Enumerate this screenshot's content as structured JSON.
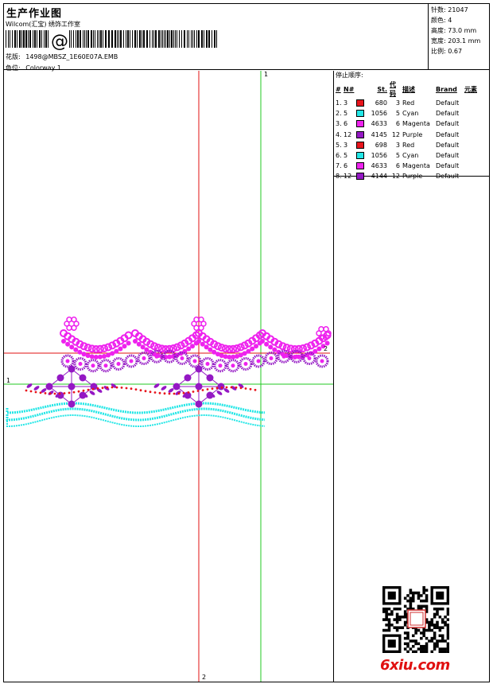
{
  "header": {
    "title": "生产作业图",
    "company": "Wilcom(汇宝) 绣饰工作室",
    "design_label": "花版:",
    "design_value": "1498@MBSZ_1E60E07A.EMB",
    "colorway_label": "色位:",
    "colorway_value": "Colorway 1"
  },
  "stats": {
    "stitches": "针数: 21047",
    "colors": "颜色: 4",
    "height": "高度: 73.0 mm",
    "width": "宽度: 203.1 mm",
    "scale": "比例: 0.67"
  },
  "stop_sequence": {
    "title": "停止顺序:",
    "columns": [
      "#",
      "N#",
      "St.",
      "代码",
      "描述",
      "Brand",
      "元素"
    ],
    "rows": [
      {
        "num": "1.",
        "n": "3",
        "color": "#e8141c",
        "st": "680",
        "code": "3",
        "desc": "Red",
        "brand": "Default"
      },
      {
        "num": "2.",
        "n": "5",
        "color": "#22e6e6",
        "st": "1056",
        "code": "5",
        "desc": "Cyan",
        "brand": "Default"
      },
      {
        "num": "3.",
        "n": "6",
        "color": "#ee22ee",
        "st": "4633",
        "code": "6",
        "desc": "Magenta",
        "brand": "Default"
      },
      {
        "num": "4.",
        "n": "12",
        "color": "#9418c4",
        "st": "4145",
        "code": "12",
        "desc": "Purple",
        "brand": "Default"
      },
      {
        "num": "5.",
        "n": "3",
        "color": "#e8141c",
        "st": "698",
        "code": "3",
        "desc": "Red",
        "brand": "Default"
      },
      {
        "num": "6.",
        "n": "5",
        "color": "#22e6e6",
        "st": "1056",
        "code": "5",
        "desc": "Cyan",
        "brand": "Default"
      },
      {
        "num": "7.",
        "n": "6",
        "color": "#ee22ee",
        "st": "4633",
        "code": "6",
        "desc": "Magenta",
        "brand": "Default"
      },
      {
        "num": "8.",
        "n": "12",
        "color": "#9418c4",
        "st": "4144",
        "code": "12",
        "desc": "Purple",
        "brand": "Default"
      }
    ]
  },
  "guides": {
    "vertical_top_label": "1",
    "vertical_bottom_label": "2",
    "horizontal_left_label": "1",
    "horizontal_right_label": "2"
  },
  "colors": {
    "red_guide": "#e01010",
    "green_guide": "#22c822",
    "cyan": "#22e6e6",
    "magenta": "#ee22ee",
    "purple": "#9418c4",
    "red": "#e8141c"
  },
  "watermark": "6xiu.com"
}
